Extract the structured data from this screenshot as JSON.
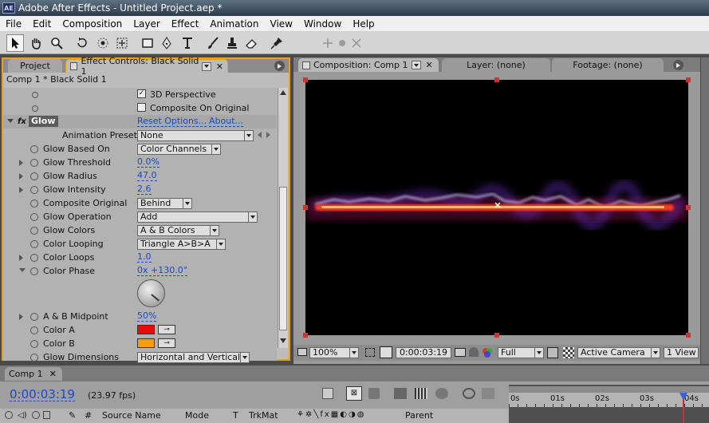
{
  "app": {
    "title": "Adobe After Effects - Untitled Project.aep *",
    "icon_text": "AE"
  },
  "menu": [
    "File",
    "Edit",
    "Composition",
    "Layer",
    "Effect",
    "Animation",
    "View",
    "Window",
    "Help"
  ],
  "tools": [
    "selection-tool",
    "hand-tool",
    "zoom-tool",
    "rotation-tool",
    "camera-orbit-tool",
    "pan-behind-tool",
    "rectangle-mask-tool",
    "pen-tool",
    "type-tool",
    "brush-tool",
    "clone-stamp-tool",
    "eraser-tool",
    "puppet-pin-tool"
  ],
  "left_panel": {
    "tabs": {
      "project": "Project",
      "effect_controls": "Effect Controls: Black Solid 1"
    },
    "header": "Comp 1 * Black Solid 1",
    "checkbox_3d": "3D Perspective",
    "checkbox_composite": "Composite On Original",
    "effect_name": "Glow",
    "fx_label": "fx",
    "reset_label": "Reset Options...",
    "about_label": "About...",
    "presets_label": "Animation Presets:",
    "presets_value": "None",
    "properties": [
      {
        "name": "Glow Based On",
        "value": "Color Channels",
        "kind": "dropdown"
      },
      {
        "name": "Glow Threshold",
        "value": "0.0%",
        "kind": "number"
      },
      {
        "name": "Glow Radius",
        "value": "47.0",
        "kind": "number"
      },
      {
        "name": "Glow Intensity",
        "value": "2.6",
        "kind": "number"
      },
      {
        "name": "Composite Original",
        "value": "Behind",
        "kind": "dropdown"
      },
      {
        "name": "Glow Operation",
        "value": "Add",
        "kind": "dropdown"
      },
      {
        "name": "Glow Colors",
        "value": "A & B Colors",
        "kind": "dropdown"
      },
      {
        "name": "Color Looping",
        "value": "Triangle A>B>A",
        "kind": "dropdown"
      },
      {
        "name": "Color Loops",
        "value": "1.0",
        "kind": "number"
      },
      {
        "name": "Color Phase",
        "value": "0x +130.0°",
        "kind": "number"
      },
      {
        "name": "A & B Midpoint",
        "value": "50%",
        "kind": "number"
      },
      {
        "name": "Color A",
        "value": "",
        "kind": "color",
        "color": "#e80c0c"
      },
      {
        "name": "Color B",
        "value": "",
        "kind": "color",
        "color": "#f0a010"
      },
      {
        "name": "Glow Dimensions",
        "value": "Horizontal and Vertical",
        "kind": "dropdown"
      }
    ]
  },
  "comp_panel": {
    "tabs": {
      "composition": "Composition: Comp 1",
      "layer": "Layer: (none)",
      "footage": "Footage: (none)"
    },
    "footer": {
      "zoom": "100%",
      "timecode": "0:00:03:19",
      "resolution": "Full",
      "camera": "Active Camera",
      "view": "1 View"
    }
  },
  "timeline": {
    "tab": "Comp 1",
    "current_time": "0:00:03:19",
    "fps": "(23.97 fps)",
    "columns": {
      "source_name": "Source Name",
      "mode": "Mode",
      "t": "T",
      "trkmat": "TrkMat",
      "parent": "Parent"
    },
    "ruler": [
      "0s",
      "01s",
      "02s",
      "03s",
      "04s"
    ]
  },
  "colors": {
    "accent_orange": "#e8a219",
    "link_blue": "#1b48c4",
    "timecode_blue": "#1d49c8",
    "playhead": "#d23030"
  }
}
